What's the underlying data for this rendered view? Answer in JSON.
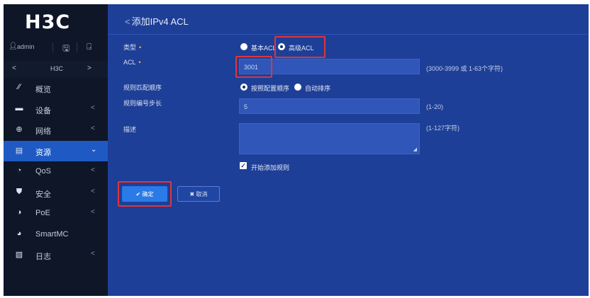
{
  "brand": {
    "logo_text": "H3C"
  },
  "user": {
    "name": "admin",
    "save_icon": "save-icon",
    "logout_icon": "logout-icon"
  },
  "device_nav": {
    "prev": "<",
    "name": "H3C",
    "next": ">"
  },
  "sidebar": {
    "items": [
      {
        "icon": "dashboard-icon",
        "glyph": "⁄⁄",
        "label": "概览",
        "chevron": ""
      },
      {
        "icon": "device-icon",
        "glyph": "▬",
        "label": "设备",
        "chevron": "<"
      },
      {
        "icon": "network-icon",
        "glyph": "⊕",
        "label": "网络",
        "chevron": "<"
      },
      {
        "icon": "resource-icon",
        "glyph": "▤",
        "label": "资源",
        "chevron": "⌄",
        "active": true
      },
      {
        "icon": "qos-icon",
        "glyph": "◔",
        "label": "QoS",
        "chevron": "<"
      },
      {
        "icon": "security-icon",
        "glyph": "⛊",
        "label": "安全",
        "chevron": "<"
      },
      {
        "icon": "poe-icon",
        "glyph": "◑",
        "label": "PoE",
        "chevron": "<"
      },
      {
        "icon": "smartmc-icon",
        "glyph": "◕",
        "label": "SmartMC",
        "chevron": ""
      },
      {
        "icon": "log-icon",
        "glyph": "▧",
        "label": "日志",
        "chevron": "<"
      }
    ]
  },
  "page": {
    "back": "<",
    "title": "添加IPv4 ACL"
  },
  "form": {
    "type_label": "类型",
    "type_options": [
      {
        "label": "基本ACL",
        "selected": false
      },
      {
        "label": "高级ACL",
        "selected": true
      }
    ],
    "acl_label": "ACL",
    "acl_value": "3001",
    "acl_hint": "(3000-3999 或 1-63个字符)",
    "match_label": "规则匹配顺序",
    "match_options": [
      {
        "label": "按照配置顺序",
        "selected": true
      },
      {
        "label": "自动排序",
        "selected": false
      }
    ],
    "step_label": "规则编号步长",
    "step_value": "5",
    "step_hint": "(1-20)",
    "desc_label": "描述",
    "desc_value": "",
    "desc_hint": "(1-127字符)",
    "start_rule_label": "开始添加规则",
    "start_rule_checked": true
  },
  "buttons": {
    "ok": "✔ 确定",
    "cancel": "✖ 取消"
  },
  "colors": {
    "highlight": "#e0353b",
    "main_bg": "#1e3f97",
    "active_item": "#1f5ac4"
  }
}
